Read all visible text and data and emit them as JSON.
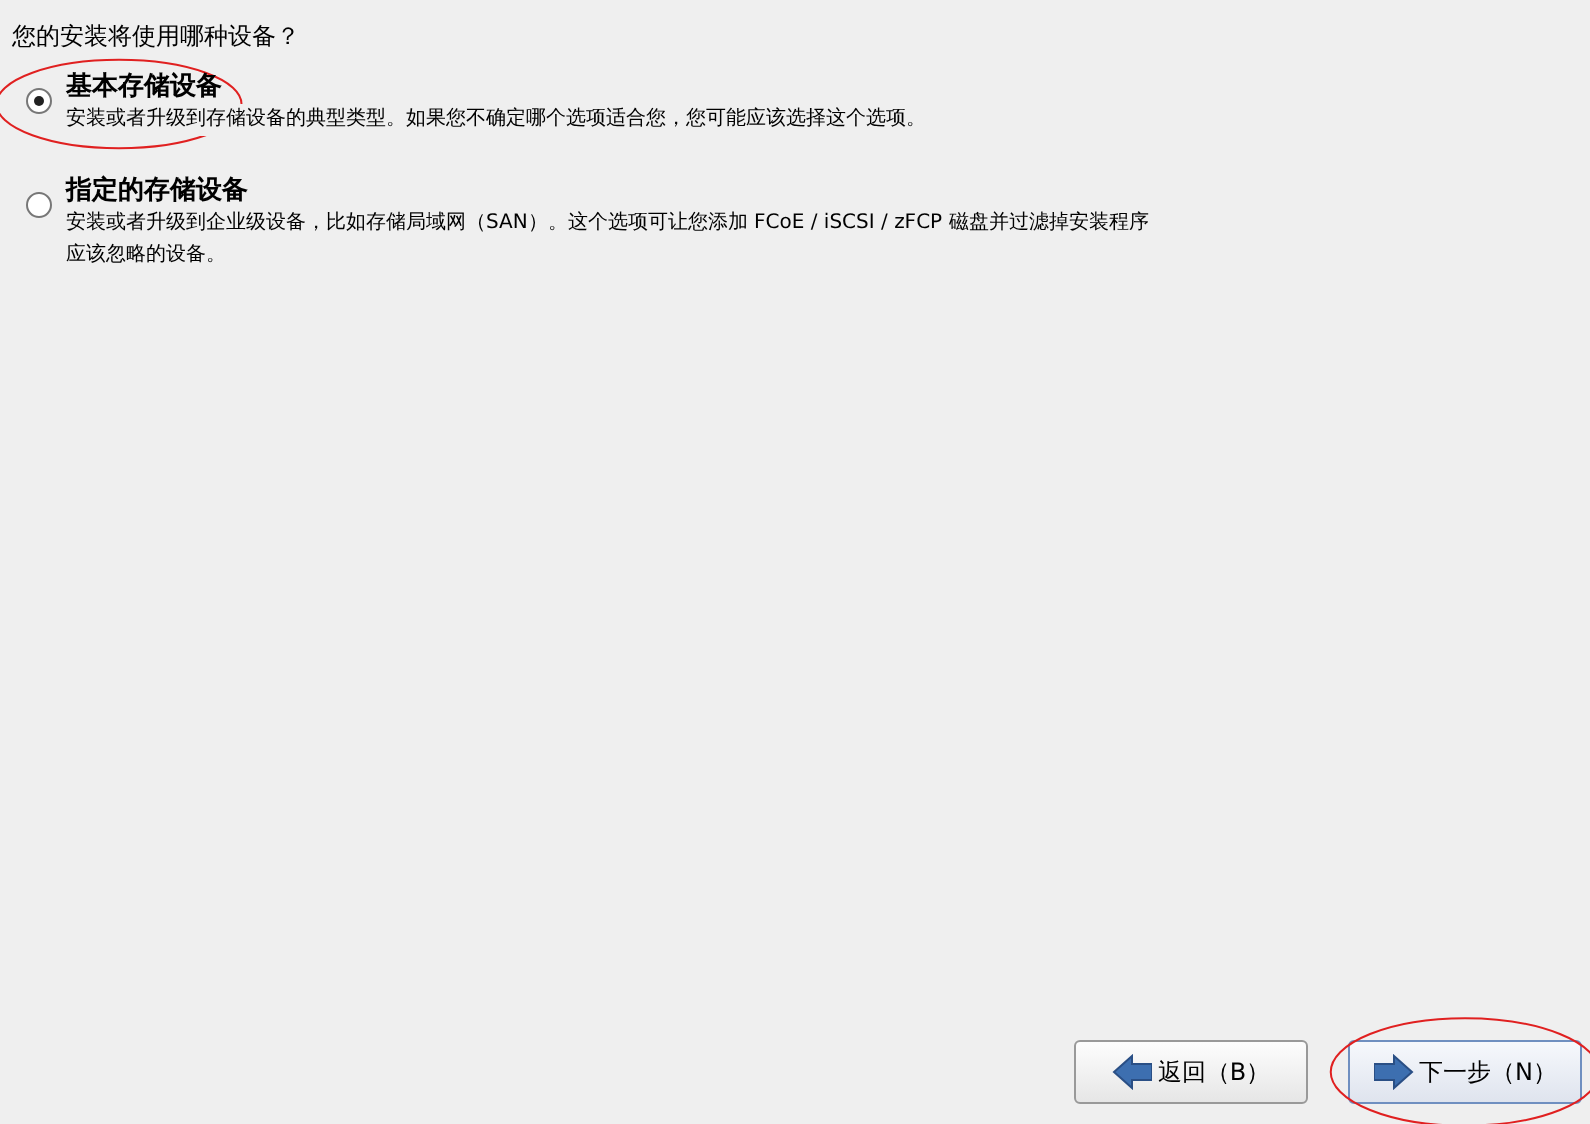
{
  "question": "您的安装将使用哪种设备？",
  "options": [
    {
      "title": "基本存储设备",
      "description_lines": [
        "安装或者升级到存储设备的典型类型。如果您不确定哪个选项适合您，您可能应该选择这个选项。"
      ],
      "selected": true,
      "circled": true
    },
    {
      "title": "指定的存储设备",
      "description_lines": [
        "安装或者升级到企业级设备，比如存储局域网（SAN）。这个选项可让您添加 FCoE / iSCSI / zFCP 磁盘并过滤掉安装程序",
        "应该忽略的设备。"
      ],
      "selected": false,
      "circled": false
    }
  ],
  "buttons": [
    {
      "label": "返回（B）",
      "kind": "back",
      "default": false,
      "circled": false
    },
    {
      "label": "下一步（N）",
      "kind": "next",
      "default": true,
      "circled": true
    }
  ]
}
